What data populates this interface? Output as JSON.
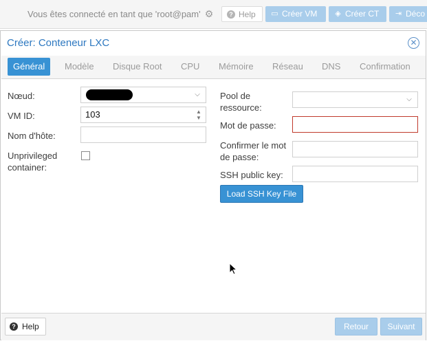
{
  "topbar": {
    "logged_in_text": "Vous êtes connecté en tant que 'root@pam'",
    "help_label": "Help",
    "create_vm_label": "Créer VM",
    "create_ct_label": "Créer CT",
    "logout_label": "Déco"
  },
  "dialog": {
    "title": "Créer: Conteneur LXC",
    "tabs": [
      {
        "label": "Général",
        "active": true
      },
      {
        "label": "Modèle"
      },
      {
        "label": "Disque Root"
      },
      {
        "label": "CPU"
      },
      {
        "label": "Mémoire"
      },
      {
        "label": "Réseau"
      },
      {
        "label": "DNS"
      },
      {
        "label": "Confirmation"
      }
    ]
  },
  "form": {
    "node_label": "Nœud:",
    "vmid_label": "VM ID:",
    "vmid_value": "103",
    "hostname_label": "Nom d'hôte:",
    "unprivileged_label": "Unprivileged container:",
    "unprivileged_checked": false,
    "pool_label": "Pool de ressource:",
    "password_label": "Mot de passe:",
    "confirm_password_label": "Confirmer le mot de passe:",
    "ssh_key_label": "SSH public key:",
    "load_ssh_button": "Load SSH Key File"
  },
  "footer": {
    "help_label": "Help",
    "back_label": "Retour",
    "next_label": "Suivant"
  },
  "colors": {
    "accent": "#3892d4",
    "title": "#2d78c0",
    "disabled_button": "#a9cdeb",
    "error_border": "#c0392b"
  }
}
